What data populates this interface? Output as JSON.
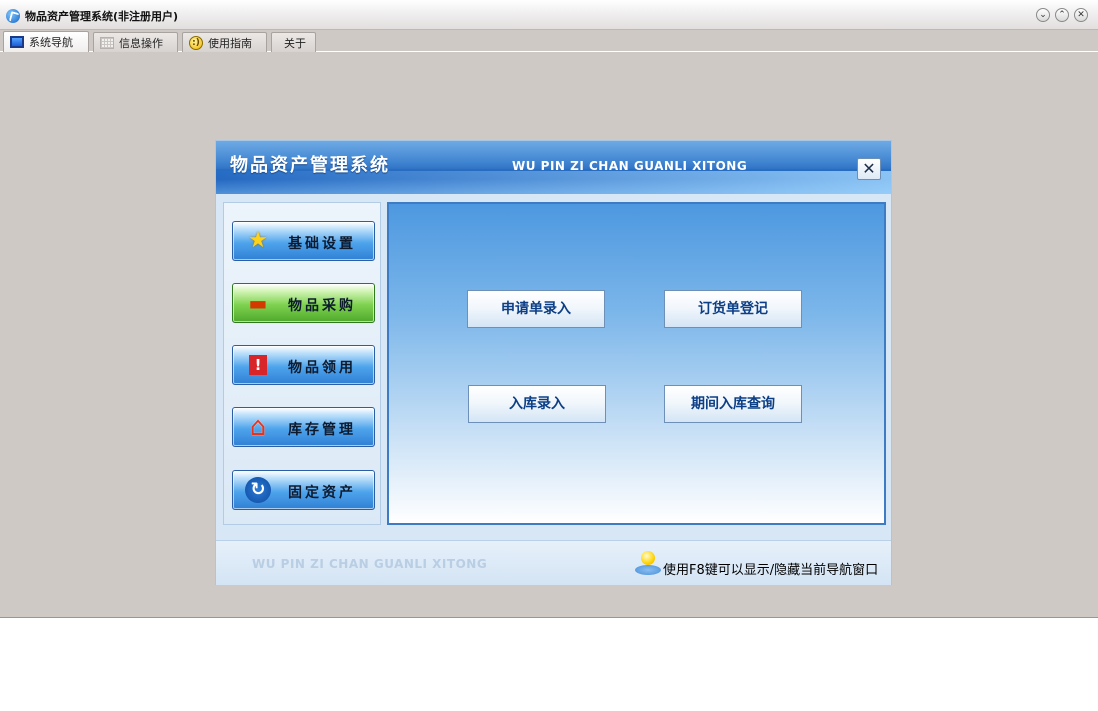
{
  "window": {
    "title": "物品资产管理系统(非注册用户)",
    "controls": {
      "minimize": "⌄",
      "maximize": "⌃",
      "close": "✕"
    }
  },
  "tabs": [
    {
      "label": "系统导航",
      "icon": "monitor-icon",
      "active": true
    },
    {
      "label": "信息操作",
      "icon": "grid-icon",
      "active": false
    },
    {
      "label": "使用指南",
      "icon": "help-icon",
      "active": false
    },
    {
      "label": "关于",
      "icon": "",
      "active": false
    }
  ],
  "dialog": {
    "title": "物品资产管理系统",
    "subtitle": "WU PIN ZI CHAN GUANLI XITONG",
    "close_glyph": "✕",
    "nav": [
      {
        "label": "基础设置",
        "icon": "star-icon",
        "glyph": "★",
        "active": false
      },
      {
        "label": "物品采购",
        "icon": "monitor-icon",
        "glyph": "▬",
        "active": true
      },
      {
        "label": "物品领用",
        "icon": "alert-monitor-icon",
        "glyph": "!",
        "active": false
      },
      {
        "label": "库存管理",
        "icon": "home-icon",
        "glyph": "⌂",
        "active": false
      },
      {
        "label": "固定资产",
        "icon": "refresh-icon",
        "glyph": "↻",
        "active": false
      }
    ],
    "actions": [
      {
        "label": "申请单录入"
      },
      {
        "label": "订货单登记"
      },
      {
        "label": "入库录入"
      },
      {
        "label": "期间入库查询"
      }
    ],
    "footer": {
      "brand": "WU PIN ZI CHAN GUANLI XITONG",
      "tip": "使用F8键可以显示/隐藏当前导航窗口"
    }
  }
}
